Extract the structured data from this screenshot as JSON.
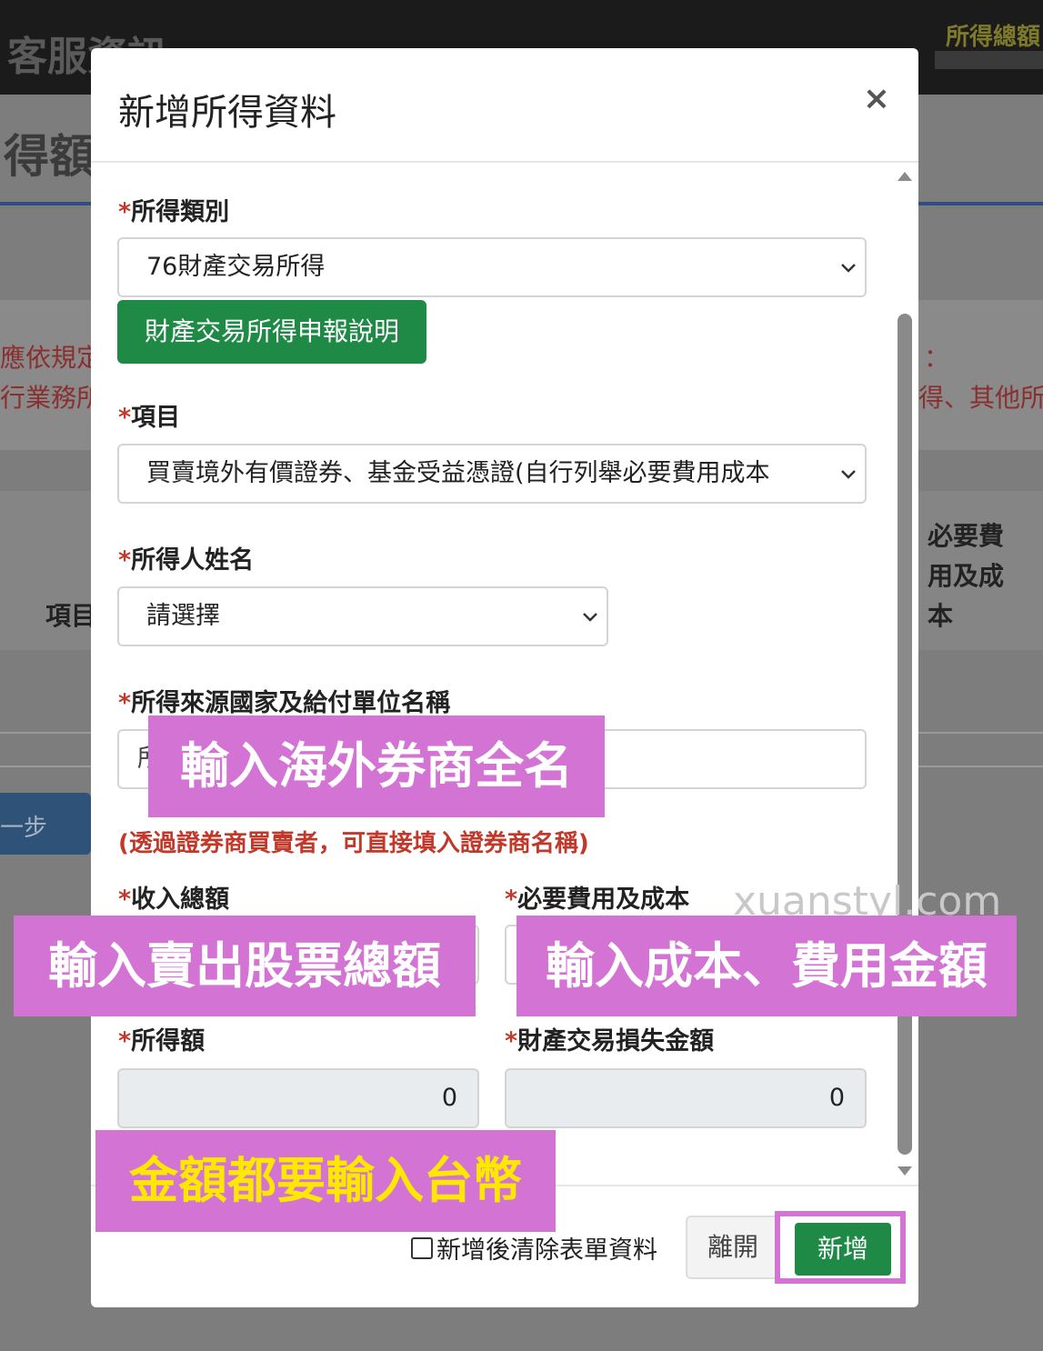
{
  "background": {
    "top_left_title": "客服資訊",
    "top_right_title": "所得總額",
    "heading": "得額",
    "red_text_1": "應依規定",
    "red_text_2": "行業務所",
    "red_text_3": "：",
    "red_text_4": "得、其他所",
    "column_item": "項目",
    "column_cost": "必要費用及成本",
    "prev_step": "一步"
  },
  "modal": {
    "title": "新增所得資料",
    "close_symbol": "×",
    "income_type": {
      "label": "所得類別",
      "value": "76財產交易所得"
    },
    "guide_button": "財產交易所得申報說明",
    "item": {
      "label": "項目",
      "value": "買賣境外有價證券、基金受益憑證(自行列舉必要費用成本"
    },
    "earner_name": {
      "label": "所得人姓名",
      "value": "請選擇"
    },
    "source": {
      "label": "所得來源國家及給付單位名稱",
      "placeholder": "所"
    },
    "source_note": "(透過證券商買賣者，可直接填入證券商名稱)",
    "total_income": {
      "label": "收入總額"
    },
    "necessary_cost": {
      "label": "必要費用及成本"
    },
    "income_amount": {
      "label": "所得額",
      "value": "0"
    },
    "loss_amount": {
      "label": "財產交易損失金額",
      "value": "0"
    },
    "clear_checkbox": "新增後清除表單資料",
    "leave_button": "離開",
    "add_button": "新增"
  },
  "annotations": {
    "broker": "輸入海外券商全名",
    "sell_total": "輸入賣出股票總額",
    "cost": "輸入成本、費用金額",
    "twd": "金額都要輸入台幣"
  },
  "watermark": "xuanstyl.com",
  "colors": {
    "green": "#1e8a46",
    "annotation_pink": "#d374d4",
    "required_red": "#c0392b",
    "highlight_yellow": "#ffe800"
  }
}
